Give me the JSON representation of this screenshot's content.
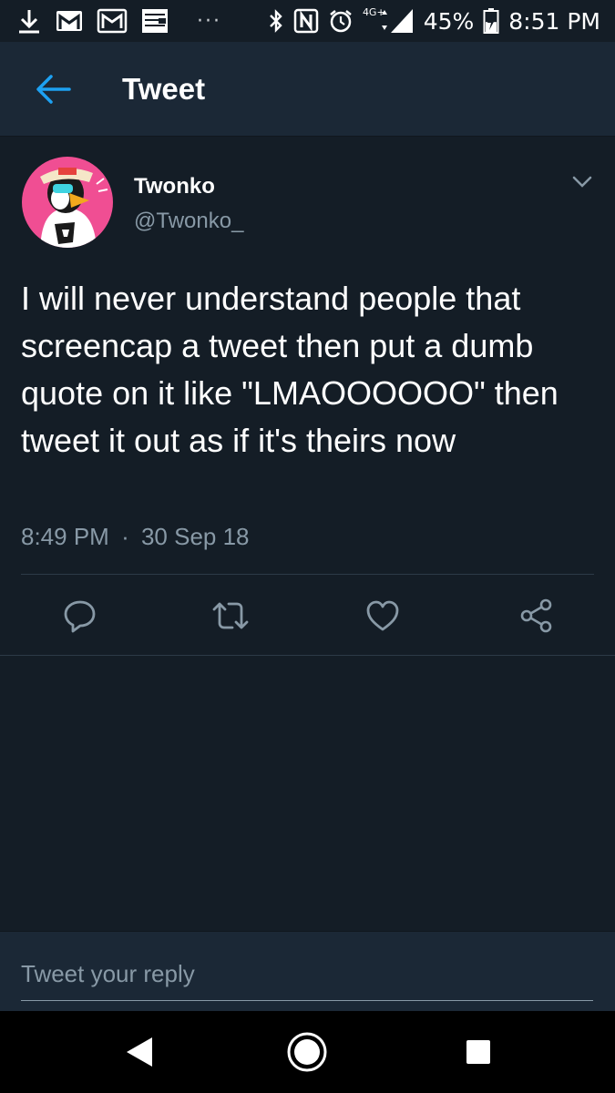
{
  "status_bar": {
    "left_icons": [
      "download-icon",
      "gmail-icon",
      "gmail-outline-icon",
      "gallery-icon"
    ],
    "overflow_dots": "···",
    "right_icons": [
      "bluetooth-icon",
      "nfc-icon",
      "alarm-icon",
      "signal-icon"
    ],
    "network_label": "4G+",
    "battery": "45%",
    "battery_level": 0.45,
    "time": "8:51 PM"
  },
  "header": {
    "back_icon": "arrow-left-icon",
    "title": "Tweet"
  },
  "tweet": {
    "author": {
      "display_name": "Twonko",
      "handle": "@Twonko_"
    },
    "text": "I will never understand people that screencap a tweet then put a dumb quote on it like \"LMAOOOOOO\" then tweet it out as if it's theirs now",
    "time": "8:49 PM",
    "separator": "·",
    "date": "30 Sep 18",
    "actions": [
      "reply-icon",
      "retweet-icon",
      "like-icon",
      "share-icon"
    ]
  },
  "reply": {
    "placeholder": "Tweet your reply"
  },
  "colors": {
    "background": "#141d26",
    "header": "#1b2836",
    "accent": "#1da1f2",
    "secondary_text": "#8899a6"
  }
}
